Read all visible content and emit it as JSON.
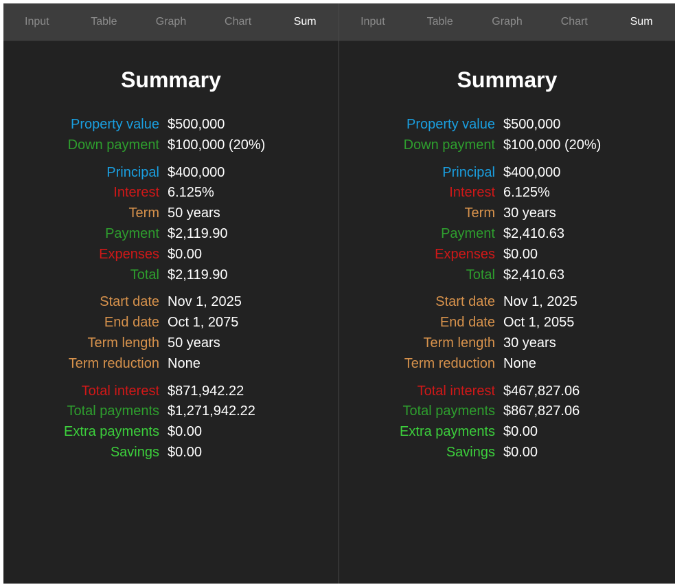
{
  "colors": {
    "blue": "#1a9fe0",
    "green": "#2e9e2e",
    "bright_green": "#3ccf3c",
    "red": "#d01818",
    "orange": "#d7924c"
  },
  "panels": [
    {
      "tabs": [
        {
          "label": "Input",
          "active": false
        },
        {
          "label": "Table",
          "active": false
        },
        {
          "label": "Graph",
          "active": false
        },
        {
          "label": "Chart",
          "active": false
        },
        {
          "label": "Sum",
          "active": true
        }
      ],
      "title": "Summary",
      "groups": [
        [
          {
            "label": "Property value",
            "value": "$500,000",
            "color": "blue"
          },
          {
            "label": "Down payment",
            "value": "$100,000 (20%)",
            "color": "green"
          }
        ],
        [
          {
            "label": "Principal",
            "value": "$400,000",
            "color": "blue"
          },
          {
            "label": "Interest",
            "value": "6.125%",
            "color": "red"
          },
          {
            "label": "Term",
            "value": "50 years",
            "color": "orange"
          },
          {
            "label": "Payment",
            "value": "$2,119.90",
            "color": "green"
          },
          {
            "label": "Expenses",
            "value": "$0.00",
            "color": "red"
          },
          {
            "label": "Total",
            "value": "$2,119.90",
            "color": "green"
          }
        ],
        [
          {
            "label": "Start date",
            "value": "Nov 1, 2025",
            "color": "orange"
          },
          {
            "label": "End date",
            "value": "Oct 1, 2075",
            "color": "orange"
          },
          {
            "label": "Term length",
            "value": "50 years",
            "color": "orange"
          },
          {
            "label": "Term reduction",
            "value": "None",
            "color": "orange"
          }
        ],
        [
          {
            "label": "Total interest",
            "value": "$871,942.22",
            "color": "red"
          },
          {
            "label": "Total payments",
            "value": "$1,271,942.22",
            "color": "green"
          },
          {
            "label": "Extra payments",
            "value": "$0.00",
            "color": "bright_green"
          },
          {
            "label": "Savings",
            "value": "$0.00",
            "color": "bright_green"
          }
        ]
      ]
    },
    {
      "tabs": [
        {
          "label": "Input",
          "active": false
        },
        {
          "label": "Table",
          "active": false
        },
        {
          "label": "Graph",
          "active": false
        },
        {
          "label": "Chart",
          "active": false
        },
        {
          "label": "Sum",
          "active": true
        }
      ],
      "title": "Summary",
      "groups": [
        [
          {
            "label": "Property value",
            "value": "$500,000",
            "color": "blue"
          },
          {
            "label": "Down payment",
            "value": "$100,000 (20%)",
            "color": "green"
          }
        ],
        [
          {
            "label": "Principal",
            "value": "$400,000",
            "color": "blue"
          },
          {
            "label": "Interest",
            "value": "6.125%",
            "color": "red"
          },
          {
            "label": "Term",
            "value": "30 years",
            "color": "orange"
          },
          {
            "label": "Payment",
            "value": "$2,410.63",
            "color": "green"
          },
          {
            "label": "Expenses",
            "value": "$0.00",
            "color": "red"
          },
          {
            "label": "Total",
            "value": "$2,410.63",
            "color": "green"
          }
        ],
        [
          {
            "label": "Start date",
            "value": "Nov 1, 2025",
            "color": "orange"
          },
          {
            "label": "End date",
            "value": "Oct 1, 2055",
            "color": "orange"
          },
          {
            "label": "Term length",
            "value": "30 years",
            "color": "orange"
          },
          {
            "label": "Term reduction",
            "value": "None",
            "color": "orange"
          }
        ],
        [
          {
            "label": "Total interest",
            "value": "$467,827.06",
            "color": "red"
          },
          {
            "label": "Total payments",
            "value": "$867,827.06",
            "color": "green"
          },
          {
            "label": "Extra payments",
            "value": "$0.00",
            "color": "bright_green"
          },
          {
            "label": "Savings",
            "value": "$0.00",
            "color": "bright_green"
          }
        ]
      ]
    }
  ]
}
